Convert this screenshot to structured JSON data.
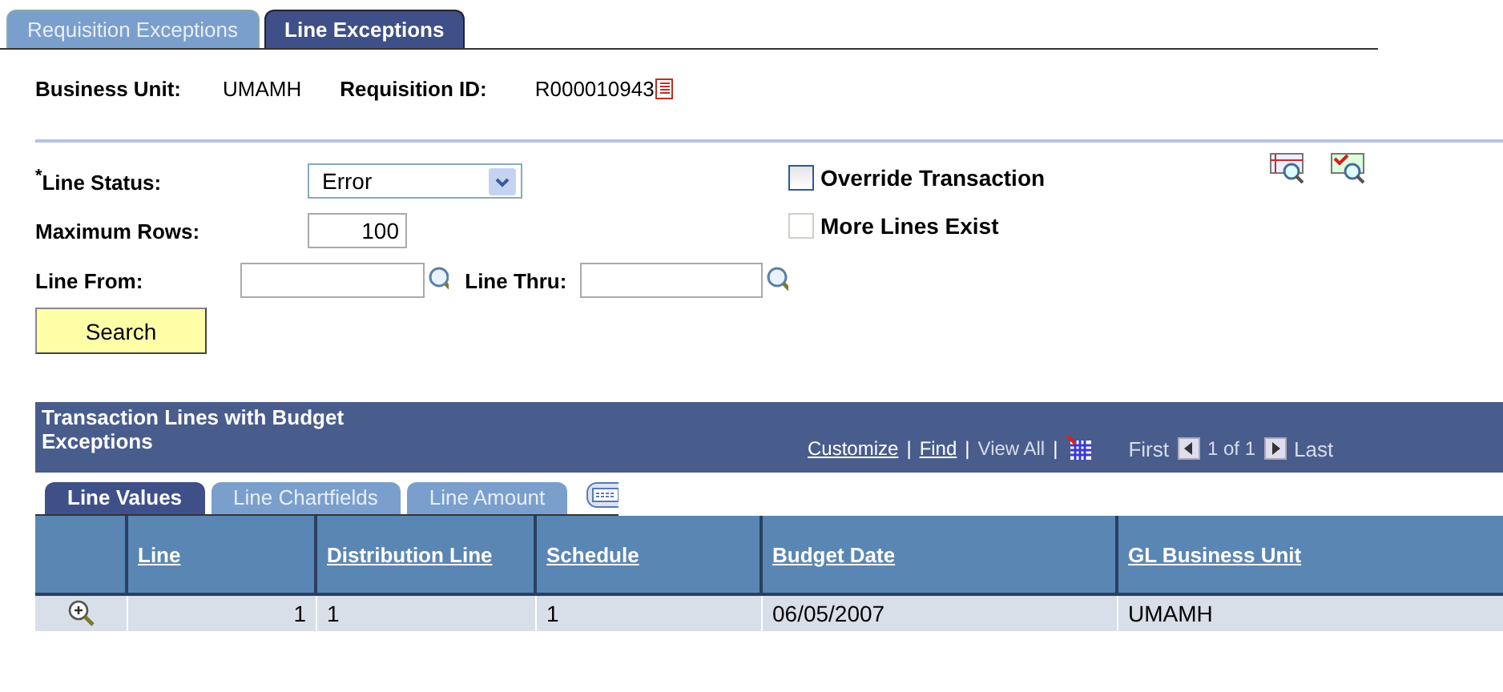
{
  "tabs": [
    {
      "label": "Requisition Exceptions",
      "selected": false
    },
    {
      "label": "Line Exceptions",
      "selected": true
    }
  ],
  "header": {
    "business_unit_label": "Business Unit:",
    "business_unit": "UMAMH",
    "requisition_label": "Requisition ID:",
    "requisition_id": "R000010943"
  },
  "form": {
    "line_status_label": "$^{*}$Line Status:",
    "line_status": "Error",
    "max_rows_label": "Maximum Rows:",
    "max_rows": "100",
    "line_from_label": "Line From:",
    "line_thru_label": "Line Thru:",
    "override": {
      "label": "Override Transaction",
      "checked": false,
      "disabled": false
    },
    "more_lines": {
      "label": "More Lines Exist",
      "checked": false,
      "disabled": true
    },
    "search_button": "Search"
  },
  "grid": {
    "title": "Transaction Lines with Budget Exceptions",
    "links": [
      {
        "label": "Customize",
        "kind": "link",
        "separator": "|"
      },
      {
        "label": "Find",
        "kind": "link",
        "separator": "|"
      },
      {
        "label": "View All",
        "kind": "plain",
        "separator": "|"
      }
    ],
    "nav": {
      "first": "First",
      "count": "1 of 1",
      "last": "Last"
    },
    "tabs": [
      {
        "label": "Line Values",
        "selected": true
      },
      {
        "label": "Line Chartfields",
        "selected": false
      },
      {
        "label": "Line Amount",
        "selected": false
      }
    ],
    "columns": [
      "Line",
      "Distribution Line",
      "Schedule",
      "Budget Date",
      "GL Business Unit"
    ],
    "rows": [
      [
        "1",
        "1",
        "1",
        "06/05/2007",
        "UMAMH"
      ]
    ]
  }
}
